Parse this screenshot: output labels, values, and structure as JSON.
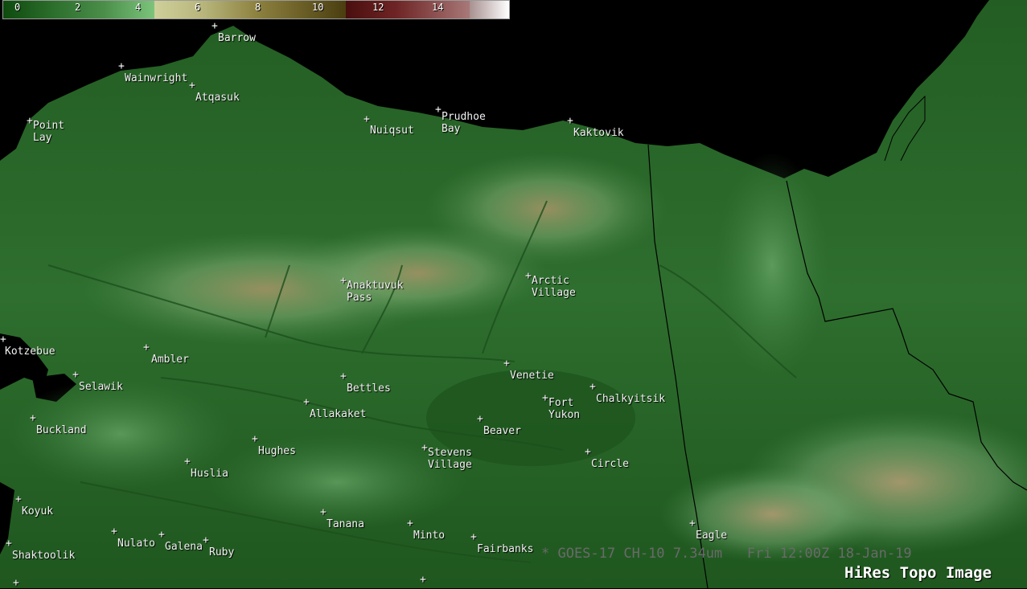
{
  "colorbar": {
    "ticks": [
      "0",
      "2",
      "4",
      "6",
      "8",
      "10",
      "12",
      "14"
    ],
    "segments": [
      "#1c5c1c",
      "#3a8a3a",
      "#7cc47c",
      "#c8c88c",
      "#a8a060",
      "#6a5a20",
      "#5a1818",
      "#8a5050",
      "#c0a8a8",
      "#ffffff"
    ]
  },
  "cities": [
    {
      "name": "Barrow"
    },
    {
      "name": "Wainwright"
    },
    {
      "name": "Atqasuk"
    },
    {
      "name": "Point\nLay"
    },
    {
      "name": "Nuiqsut"
    },
    {
      "name": "Prudhoe\nBay"
    },
    {
      "name": "Kaktovik"
    },
    {
      "name": "Anaktuvuk\nPass"
    },
    {
      "name": "Arctic\nVillage"
    },
    {
      "name": "Kotzebue"
    },
    {
      "name": "Ambler"
    },
    {
      "name": "Selawik"
    },
    {
      "name": "Bettles"
    },
    {
      "name": "Venetie"
    },
    {
      "name": "Fort\nYukon"
    },
    {
      "name": "Chalkyitsik"
    },
    {
      "name": "Allakaket"
    },
    {
      "name": "Beaver"
    },
    {
      "name": "Buckland"
    },
    {
      "name": "Hughes"
    },
    {
      "name": "Stevens\nVillage"
    },
    {
      "name": "Circle"
    },
    {
      "name": "Huslia"
    },
    {
      "name": "Koyuk"
    },
    {
      "name": "Tanana"
    },
    {
      "name": "Minto"
    },
    {
      "name": "Eagle"
    },
    {
      "name": "Nulato"
    },
    {
      "name": "Galena"
    },
    {
      "name": "Ruby"
    },
    {
      "name": "Fairbanks"
    },
    {
      "name": "Shaktoolik"
    }
  ],
  "satellite_label": "* GOES-17 CH-10 7.34um   Fri 12:00Z 18-Jan-19",
  "topo_label": "HiRes Topo Image",
  "colors": {
    "ocean": "#000000",
    "lowland": "#1f5a1f",
    "mountain": "#b49a70"
  }
}
